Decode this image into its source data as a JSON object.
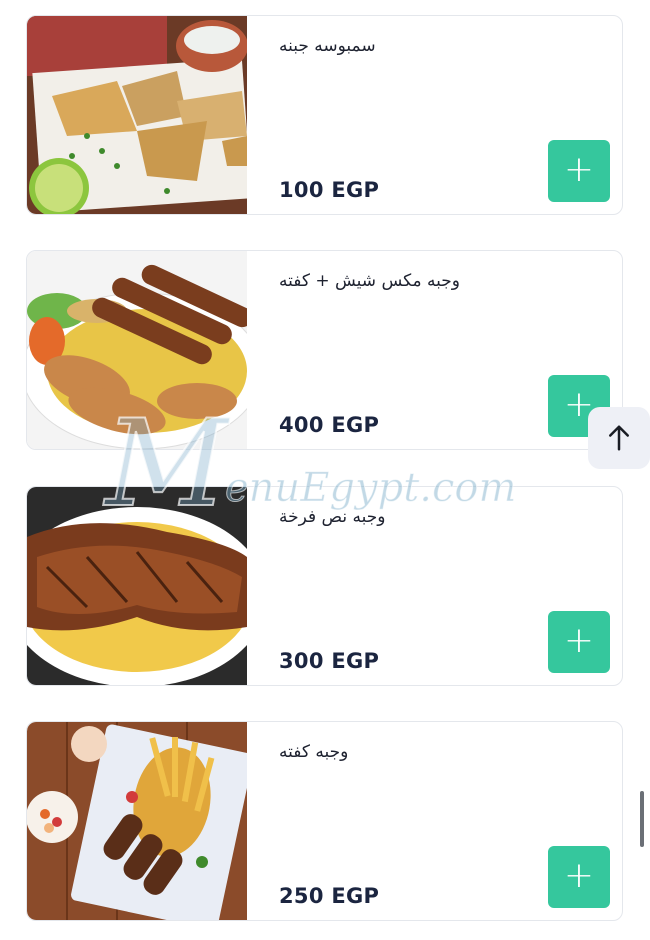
{
  "items": [
    {
      "name": "سمبوسه جبنه",
      "price": "100 EGP",
      "add_label": "+"
    },
    {
      "name": "وجبه مكس شيش + كفته",
      "price": "400 EGP",
      "add_label": "+"
    },
    {
      "name": "وجبه نص فرخة",
      "price": "300 EGP",
      "add_label": "+"
    },
    {
      "name": "وجبه كفته",
      "price": "250 EGP",
      "add_label": "+"
    }
  ],
  "watermark": {
    "text": "enuEgypt.com",
    "initial": "M"
  },
  "icons": {
    "scroll_top": "arrow-up-icon",
    "add": "plus-icon"
  },
  "colors": {
    "accent": "#35c79d",
    "price": "#1b2540"
  }
}
